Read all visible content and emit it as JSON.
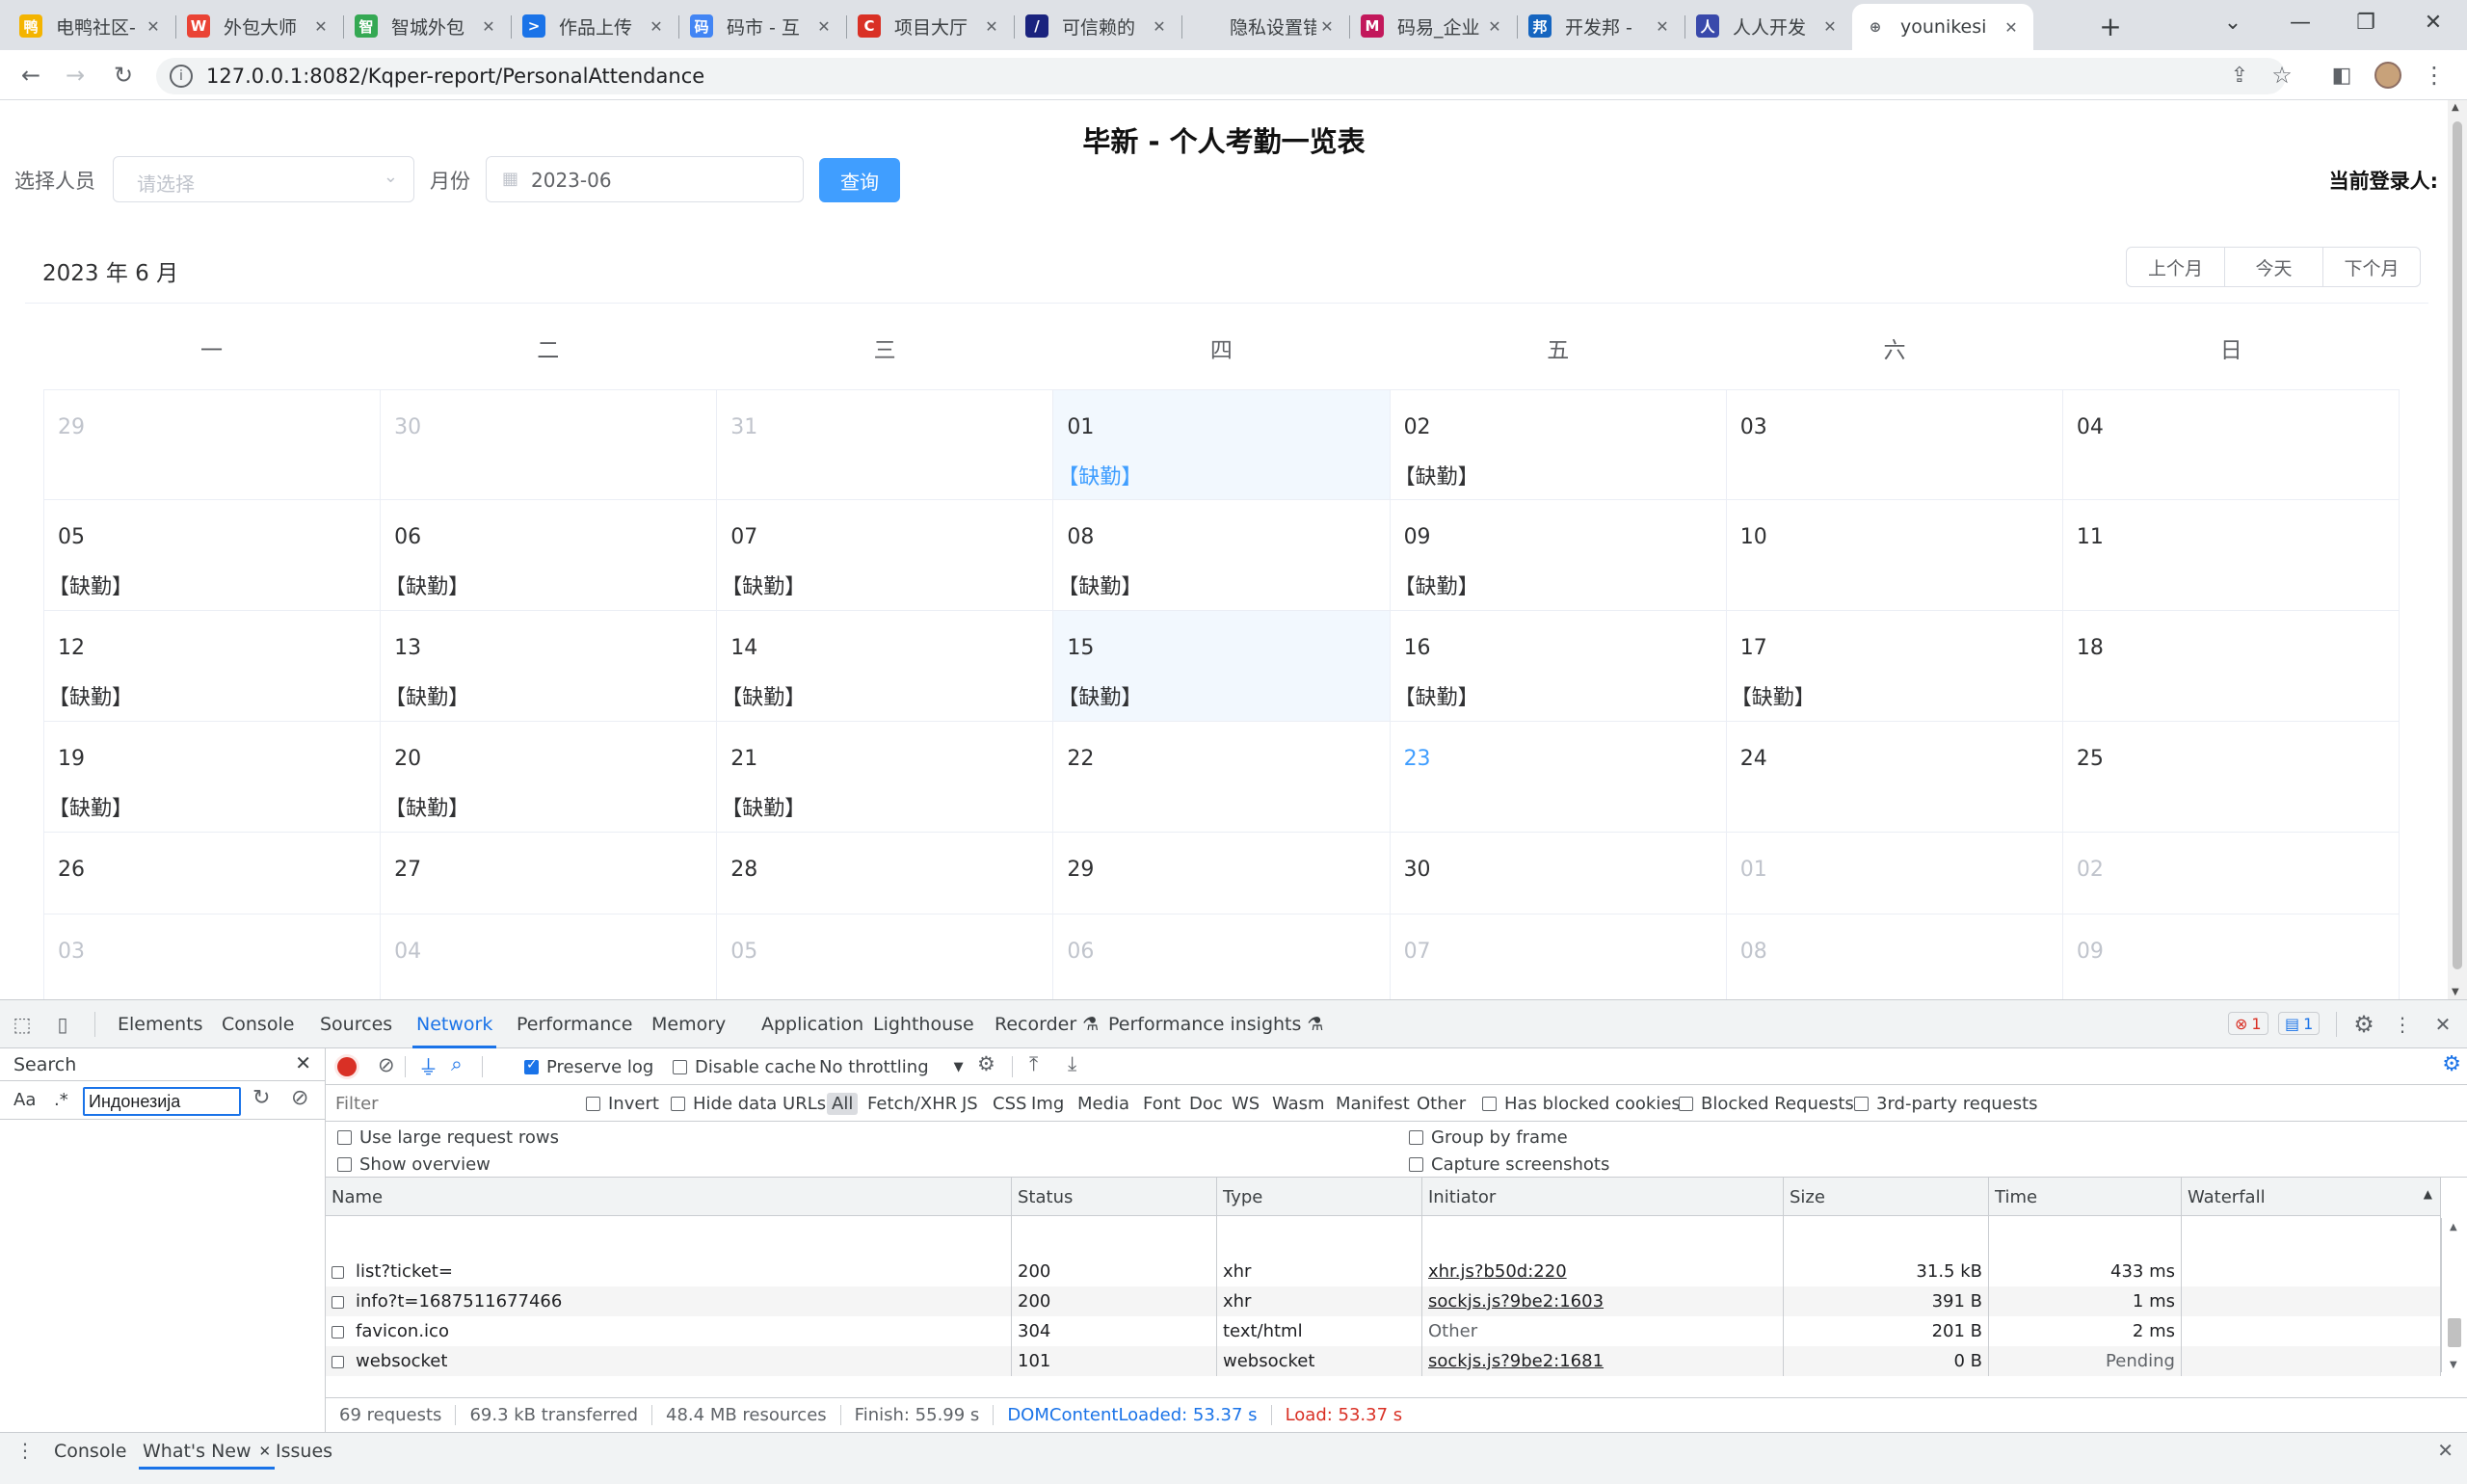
{
  "browser": {
    "tabs": [
      {
        "label": "电鸭社区-",
        "color": "#f4b400",
        "glyph": "鸭"
      },
      {
        "label": "外包大师",
        "color": "#ea4335",
        "glyph": "W"
      },
      {
        "label": "智城外包",
        "color": "#34a853",
        "glyph": "智"
      },
      {
        "label": "作品上传",
        "color": "#1a73e8",
        "glyph": ">"
      },
      {
        "label": "码市 - 互",
        "color": "#4285f4",
        "glyph": "码"
      },
      {
        "label": "项目大厅",
        "color": "#d93025",
        "glyph": "C"
      },
      {
        "label": "可信赖的",
        "color": "#1a237e",
        "glyph": "/"
      },
      {
        "label": "隐私设置错误",
        "color": "#ffffff",
        "glyph": ""
      },
      {
        "label": "码易_企业",
        "color": "#c2185b",
        "glyph": "M"
      },
      {
        "label": "开发邦 - ",
        "color": "#1565c0",
        "glyph": "邦"
      },
      {
        "label": "人人开发",
        "color": "#3949ab",
        "glyph": "人"
      },
      {
        "label": "younikesi",
        "color": "#5f6368",
        "glyph": "⊕"
      }
    ],
    "new_tab": "+",
    "url": "127.0.0.1:8082/Kqper-report/PersonalAttendance"
  },
  "page": {
    "title": "毕新 - 个人考勤一览表",
    "person_label": "选择人员",
    "person_placeholder": "请选择",
    "month_label": "月份",
    "month_value": "2023-06",
    "query_button": "查询",
    "current_user_label": "当前登录人:"
  },
  "calendar": {
    "title": "2023 年 6 月",
    "prev_month": "上个月",
    "today": "今天",
    "next_month": "下个月",
    "weekdays": [
      "一",
      "二",
      "三",
      "四",
      "五",
      "六",
      "日"
    ],
    "absent_text": "【缺勤】",
    "weeks": [
      [
        {
          "d": "29",
          "o": 1
        },
        {
          "d": "30",
          "o": 1
        },
        {
          "d": "31",
          "o": 1
        },
        {
          "d": "01",
          "sel": 1,
          "blue": 1,
          "s": 1
        },
        {
          "d": "02",
          "s": 1
        },
        {
          "d": "03"
        },
        {
          "d": "04"
        }
      ],
      [
        {
          "d": "05",
          "s": 1
        },
        {
          "d": "06",
          "s": 1
        },
        {
          "d": "07",
          "s": 1
        },
        {
          "d": "08",
          "s": 1
        },
        {
          "d": "09",
          "s": 1
        },
        {
          "d": "10"
        },
        {
          "d": "11"
        }
      ],
      [
        {
          "d": "12",
          "s": 1
        },
        {
          "d": "13",
          "s": 1
        },
        {
          "d": "14",
          "s": 1
        },
        {
          "d": "15",
          "sel": 1,
          "s": 1
        },
        {
          "d": "16",
          "s": 1
        },
        {
          "d": "17",
          "s": 1
        },
        {
          "d": "18"
        }
      ],
      [
        {
          "d": "19",
          "s": 1
        },
        {
          "d": "20",
          "s": 1
        },
        {
          "d": "21",
          "s": 1
        },
        {
          "d": "22"
        },
        {
          "d": "23",
          "today": 1
        },
        {
          "d": "24"
        },
        {
          "d": "25"
        }
      ],
      [
        {
          "d": "26"
        },
        {
          "d": "27"
        },
        {
          "d": "28"
        },
        {
          "d": "29"
        },
        {
          "d": "30"
        },
        {
          "d": "01",
          "o": 1
        },
        {
          "d": "02",
          "o": 1
        }
      ],
      [
        {
          "d": "03",
          "o": 1
        },
        {
          "d": "04",
          "o": 1
        },
        {
          "d": "05",
          "o": 1
        },
        {
          "d": "06",
          "o": 1
        },
        {
          "d": "07",
          "o": 1
        },
        {
          "d": "08",
          "o": 1
        },
        {
          "d": "09",
          "o": 1
        }
      ]
    ]
  },
  "devtools": {
    "tabs": [
      "Elements",
      "Console",
      "Sources",
      "Network",
      "Performance",
      "Memory",
      "Application",
      "Lighthouse",
      "Recorder ⚗",
      "Performance insights ⚗"
    ],
    "active_tab": "Network",
    "errors": "1",
    "messages": "1",
    "search": {
      "title": "Search",
      "case_label": "Aa",
      "regex_label": ".*",
      "query": "Индонезија"
    },
    "toolbar": {
      "preserve_log": "Preserve log",
      "disable_cache": "Disable cache",
      "throttling": "No throttling"
    },
    "filter": {
      "placeholder": "Filter",
      "invert": "Invert",
      "hide_data_urls": "Hide data URLs",
      "types": [
        "All",
        "Fetch/XHR",
        "JS",
        "CSS",
        "Img",
        "Media",
        "Font",
        "Doc",
        "WS",
        "Wasm",
        "Manifest",
        "Other"
      ],
      "blocked_cookies": "Has blocked cookies",
      "blocked_requests": "Blocked Requests",
      "third_party": "3rd-party requests"
    },
    "options": {
      "large_rows": "Use large request rows",
      "group_by_frame": "Group by frame",
      "show_overview": "Show overview",
      "capture_screenshots": "Capture screenshots"
    },
    "columns": [
      "Name",
      "Status",
      "Type",
      "Initiator",
      "Size",
      "Time",
      "Waterfall"
    ],
    "requests": [
      {
        "name": "list?ticket=",
        "status": "200",
        "type": "xhr",
        "initiator": "xhr.js?b50d:220",
        "size": "31.5 kB",
        "time": "433 ms"
      },
      {
        "name": "info?t=1687511677466",
        "status": "200",
        "type": "xhr",
        "initiator": "sockjs.js?9be2:1603",
        "size": "391 B",
        "time": "1 ms"
      },
      {
        "name": "favicon.ico",
        "status": "304",
        "type": "text/html",
        "initiator": "Other",
        "size": "201 B",
        "time": "2 ms"
      },
      {
        "name": "websocket",
        "status": "101",
        "type": "websocket",
        "initiator": "sockjs.js?9be2:1681",
        "size": "0 B",
        "time": "Pending"
      }
    ],
    "status": {
      "requests": "69 requests",
      "transferred": "69.3 kB transferred",
      "resources": "48.4 MB resources",
      "finish": "Finish: 55.99 s",
      "dcl": "DOMContentLoaded: 53.37 s",
      "load": "Load: 53.37 s"
    },
    "drawer_tabs": [
      "Console",
      "What's New",
      "Issues"
    ]
  },
  "colors": {
    "accent": "#409eff",
    "devtools_blue": "#1a73e8",
    "dcl": "#1a73e8",
    "load": "#d93025"
  }
}
